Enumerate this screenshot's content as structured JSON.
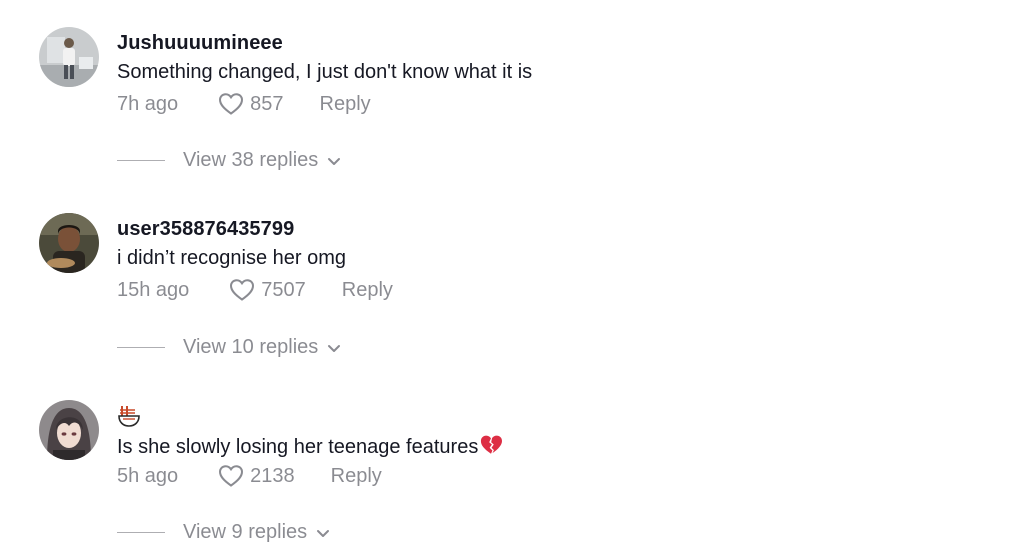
{
  "comments": [
    {
      "username": "Jushuuuumineee",
      "text": "Something changed, I just don't know what it is",
      "time": "7h ago",
      "likes": "857",
      "reply_label": "Reply",
      "view_replies": "View 38 replies"
    },
    {
      "username": "user358876435799",
      "text": "i didn’t recognise her omg",
      "time": "15h ago",
      "likes": "7507",
      "reply_label": "Reply",
      "view_replies": "View 10 replies"
    },
    {
      "username": "🍜",
      "text": "Is she slowly losing her teenage features",
      "text_emoji": "broken-heart-emoji",
      "time": "5h ago",
      "likes": "2138",
      "reply_label": "Reply",
      "view_replies": "View 9 replies"
    }
  ],
  "colors": {
    "primary_text": "#161823",
    "secondary_text": "rgba(22,24,35,0.5)",
    "broken_heart": "#e0245e"
  },
  "icons": [
    "heart-outline-icon",
    "chevron-down-icon",
    "noodle-bowl-icon",
    "broken-heart-emoji"
  ]
}
